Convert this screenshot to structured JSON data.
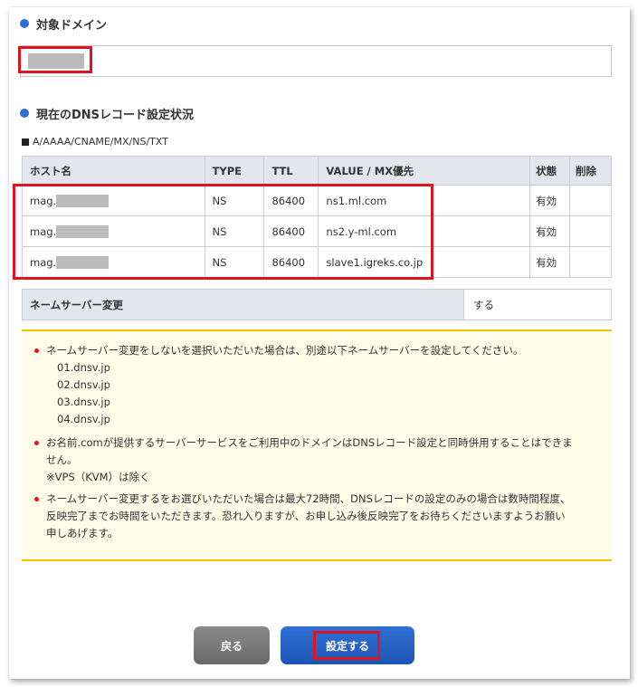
{
  "domain_section": {
    "title": "対象ドメイン",
    "domain_value": ""
  },
  "dns_section": {
    "title": "現在のDNSレコード設定状況",
    "record_types": "A/AAAA/CNAME/MX/NS/TXT",
    "columns": [
      "ホスト名",
      "TYPE",
      "TTL",
      "VALUE / MX優先",
      "状態",
      "削除"
    ],
    "rows": [
      {
        "host": "mag.",
        "type": "NS",
        "ttl": "86400",
        "value": "ns1.ml.com",
        "status": "有効",
        "delete": ""
      },
      {
        "host": "mag.",
        "type": "NS",
        "ttl": "86400",
        "value": "ns2.y-ml.com",
        "status": "有効",
        "delete": ""
      },
      {
        "host": "mag.",
        "type": "NS",
        "ttl": "86400",
        "value": "slave1.igreks.co.jp",
        "status": "有効",
        "delete": ""
      }
    ]
  },
  "nameserver_change": {
    "label": "ネームサーバー変更",
    "value": "する"
  },
  "notices": {
    "note1": "ネームサーバー変更をしないを選択いただいた場合は、別途以下ネームサーバーを設定してください。",
    "nameservers": [
      "01.dnsv.jp",
      "02.dnsv.jp",
      "03.dnsv.jp",
      "04.dnsv.jp"
    ],
    "note2_line1": "お名前.comが提供するサーバーサービスをご利用中のドメインはDNSレコード設定と同時併用することはできま",
    "note2_line2": "せん。",
    "note2_line3": "※VPS（KVM）は除く",
    "note3_line1": "ネームサーバー変更するをお選びいただいた場合は最大72時間、DNSレコードの設定のみの場合は数時間程度、",
    "note3_line2": "反映完了までお時間をいただきます。恐れ入りますが、お申し込み後反映完了をお待ちくださいますようお願い",
    "note3_line3": "申しあげます。"
  },
  "buttons": {
    "back": "戻る",
    "submit": "設定する"
  },
  "colors": {
    "accent_blue": "#2d6fd1",
    "highlight_red": "#e0141e",
    "notice_border": "#f2c400",
    "notice_bg": "#fffde8"
  }
}
